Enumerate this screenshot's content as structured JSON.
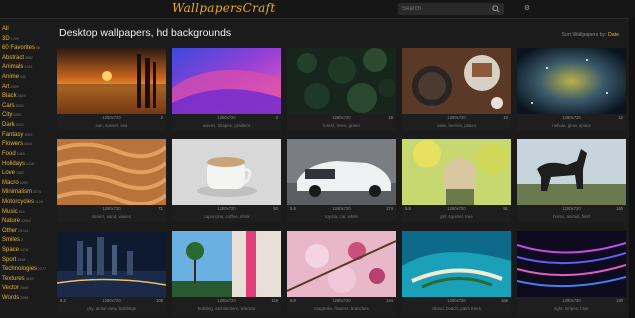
{
  "site": {
    "logo": "WallpapersCraft",
    "search_placeholder": "Search"
  },
  "page": {
    "title": "Desktop wallpapers, hd backgrounds",
    "sort_label": "Sort Wallpapers by:",
    "sort_value": "Date"
  },
  "categories": [
    {
      "name": "All",
      "count": ""
    },
    {
      "name": "3D",
      "count": "1799"
    },
    {
      "name": "60 Favorites",
      "count": "86"
    },
    {
      "name": "Abstract",
      "count": "3962"
    },
    {
      "name": "Animals",
      "count": "5763"
    },
    {
      "name": "Anime",
      "count": "940"
    },
    {
      "name": "Art",
      "count": "2699"
    },
    {
      "name": "Black",
      "count": "1829"
    },
    {
      "name": "Cars",
      "count": "3093"
    },
    {
      "name": "City",
      "count": "5380"
    },
    {
      "name": "Dark",
      "count": "4024"
    },
    {
      "name": "Fantasy",
      "count": "3093"
    },
    {
      "name": "Flowers",
      "count": "4634"
    },
    {
      "name": "Food",
      "count": "1963"
    },
    {
      "name": "Holidays",
      "count": "1016"
    },
    {
      "name": "Love",
      "count": "1452"
    },
    {
      "name": "Macro",
      "count": "6049"
    },
    {
      "name": "Minimalism",
      "count": "3276"
    },
    {
      "name": "Motorcycles",
      "count": "1104"
    },
    {
      "name": "Music",
      "count": "814"
    },
    {
      "name": "Nature",
      "count": "13594"
    },
    {
      "name": "Other",
      "count": "25144"
    },
    {
      "name": "Smiles",
      "count": "2"
    },
    {
      "name": "Space",
      "count": "4478"
    },
    {
      "name": "Sport",
      "count": "1698"
    },
    {
      "name": "Technologies",
      "count": "2277"
    },
    {
      "name": "Textures",
      "count": "4189"
    },
    {
      "name": "Vector",
      "count": "2049"
    },
    {
      "name": "Words",
      "count": "2058"
    }
  ],
  "wallpapers": [
    {
      "res": "1280x720",
      "rating": "",
      "downloads": "2",
      "tags": "sun, sunset, sea"
    },
    {
      "res": "1280x720",
      "rating": "",
      "downloads": "3",
      "tags": "waves, shapes, gradient"
    },
    {
      "res": "1280x720",
      "rating": "",
      "downloads": "18",
      "tags": "forest, trees, green"
    },
    {
      "res": "1280x720",
      "rating": "",
      "downloads": "10",
      "tags": "cake, berries, plates"
    },
    {
      "res": "1280x720",
      "rating": "",
      "downloads": "12",
      "tags": "nebula, glow, space"
    },
    {
      "res": "1280x720",
      "rating": "",
      "downloads": "71",
      "tags": "desert, sand, waves"
    },
    {
      "res": "1280x720",
      "rating": "",
      "downloads": "50",
      "tags": "capuccino, coffee, drink"
    },
    {
      "res": "1280x720",
      "rating": "5.8",
      "downloads": "174",
      "tags": "toyota, car, white"
    },
    {
      "res": "1280x720",
      "rating": "5.8",
      "downloads": "91",
      "tags": "girl, squirrel, tree"
    },
    {
      "res": "1280x720",
      "rating": "",
      "downloads": "140",
      "tags": "horse, animal, field"
    },
    {
      "res": "1280x720",
      "rating": "6.2",
      "downloads": "105",
      "tags": "city, aerial view, buildings"
    },
    {
      "res": "1280x720",
      "rating": "",
      "downloads": "119",
      "tags": "building, architecture, window"
    },
    {
      "res": "1280x720",
      "rating": "5.8",
      "downloads": "144",
      "tags": "magnolia, flowers, branches"
    },
    {
      "res": "1280x720",
      "rating": "",
      "downloads": "166",
      "tags": "island, beach, palm trees"
    },
    {
      "res": "1280x720",
      "rating": "",
      "downloads": "130",
      "tags": "light, stripes, blue"
    }
  ],
  "colors": {
    "accent": "#e2b43a",
    "background": "#1b1b1b"
  }
}
